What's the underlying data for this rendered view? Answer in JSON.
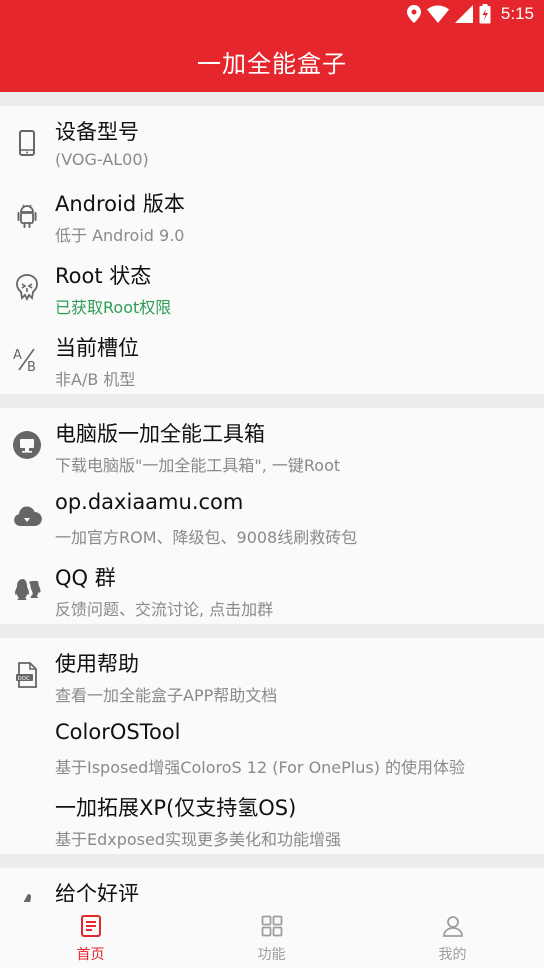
{
  "status_bar": {
    "time": "5:15",
    "icons": [
      "location-icon",
      "wifi-icon",
      "signal-icon",
      "battery-icon"
    ]
  },
  "app_bar": {
    "title": "一加全能盒子"
  },
  "sections": [
    {
      "items": [
        {
          "icon": "phone-icon",
          "title": "设备型号",
          "subtitle": "(VOG-AL00)"
        },
        {
          "icon": "android-icon",
          "title": "Android 版本",
          "subtitle": "低于 Android 9.0"
        },
        {
          "icon": "root-icon",
          "title": "Root 状态",
          "subtitle": "已获取Root权限",
          "subtitle_color": "#2e9e55"
        },
        {
          "icon": "ab-slot-icon",
          "title": "当前槽位",
          "subtitle": "非A/B 机型"
        }
      ]
    },
    {
      "items": [
        {
          "icon": "monitor-icon",
          "title": "电脑版一加全能工具箱",
          "subtitle": "下载电脑版\"一加全能工具箱\", 一键Root"
        },
        {
          "icon": "cloud-download-icon",
          "title": "op.daxiaamu.com",
          "subtitle": "一加官方ROM、降级包、9008线刷救砖包"
        },
        {
          "icon": "qq-icon",
          "title": "QQ 群",
          "subtitle": "反馈问题、交流讨论, 点击加群"
        }
      ]
    },
    {
      "items": [
        {
          "icon": "doc-icon",
          "title": "使用帮助",
          "subtitle": "查看一加全能盒子APP帮助文档"
        },
        {
          "icon": "",
          "title": "ColorOSTool",
          "subtitle": "基于Isposed增强ColoroS 12 (For OnePlus) 的使用体验"
        },
        {
          "icon": "",
          "title": "一加拓展XP(仅支持氢OS)",
          "subtitle": "基于Edxposed实现更多美化和功能增强"
        }
      ]
    },
    {
      "items": [
        {
          "icon": "thumb-up-icon",
          "title": "给个好评",
          "subtitle": ""
        }
      ]
    }
  ],
  "bottom_nav": {
    "active_color": "#e5272d",
    "items": [
      {
        "label": "首页",
        "icon": "home-doc-icon",
        "active": true
      },
      {
        "label": "功能",
        "icon": "grid-icon",
        "active": false
      },
      {
        "label": "我的",
        "icon": "person-icon",
        "active": false
      }
    ]
  }
}
